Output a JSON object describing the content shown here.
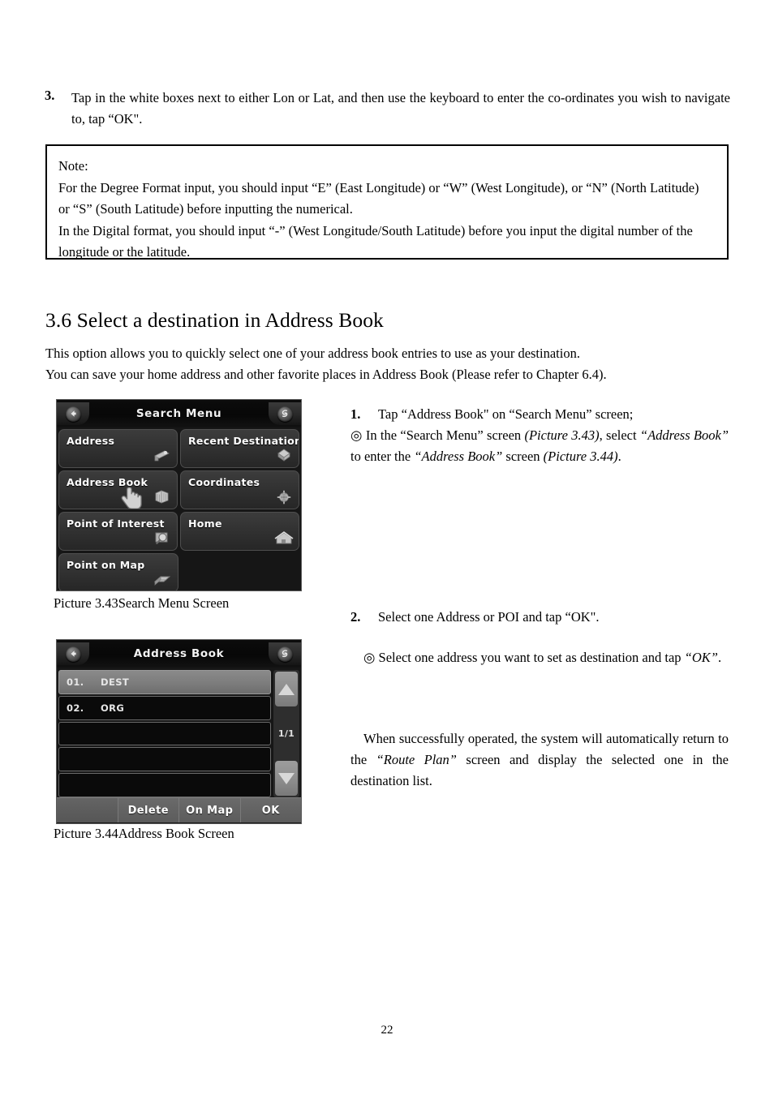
{
  "document": {
    "page_number": "22"
  },
  "step3": {
    "number": "3.",
    "text": "Tap in the white boxes next to either Lon or Lat, and then use the keyboard to enter the co-ordinates you wish to navigate to, tap “OK\"."
  },
  "note_box": {
    "label": "Note:",
    "lines": [
      "For the Degree Format input, you should input “E” (East Longitude) or “W” (West Longitude), or “N” (North Latitude)",
      "or “S” (South Latitude) before inputting the numerical.",
      "In the Digital format, you should input “-” (West Longitude/South Latitude) before you input the digital number of the",
      "longitude or the latitude."
    ]
  },
  "section": {
    "heading": "3.6 Select a destination in Address Book",
    "intro_line_1": "This option allows you to quickly select one of your address book entries to use as your destination.",
    "intro_line_2": "You can save your home address and other favorite places in Address Book (Please refer to Chapter 6.4)."
  },
  "search_menu_screen": {
    "title": "Search Menu",
    "back_icon": "back-arrow-icon",
    "right_icon": "swirl-icon",
    "buttons": [
      {
        "label": "Address",
        "icon": "road-sign-icon"
      },
      {
        "label": "Recent Destinations",
        "icon": "diamond-marker-icon"
      },
      {
        "label": "Address Book",
        "icon": "book-stack-icon"
      },
      {
        "label": "Coordinates",
        "icon": "globe-crosshair-icon"
      },
      {
        "label": "Point of Interest",
        "icon": "magnifier-map-icon"
      },
      {
        "label": "Home",
        "icon": "house-icon"
      },
      {
        "label": "Point on Map",
        "icon": "map-fold-icon"
      }
    ],
    "cursor": "hand-pointer-cursor"
  },
  "address_book_screen": {
    "title": "Address Book",
    "back_icon": "back-arrow-icon",
    "right_icon": "swirl-icon",
    "rows": [
      {
        "index": "01.",
        "name": "DEST",
        "selected": true
      },
      {
        "index": "02.",
        "name": "ORG",
        "selected": false
      },
      {
        "index": "",
        "name": "",
        "selected": false
      },
      {
        "index": "",
        "name": "",
        "selected": false
      },
      {
        "index": "",
        "name": "",
        "selected": false
      }
    ],
    "page_indicator": "1/1",
    "scroll_up_icon": "triangle-up-icon",
    "scroll_down_icon": "triangle-down-icon",
    "footer_buttons": [
      {
        "label": ""
      },
      {
        "label": "Delete"
      },
      {
        "label": "On Map"
      },
      {
        "label": "OK"
      }
    ]
  },
  "captions": {
    "picture_343": "Picture 3.43Search Menu Screen",
    "picture_344": "Picture 3.44Address Book Screen"
  },
  "right_column": {
    "item1_number": "1.",
    "item1_text": "Tap “Address Book\" on “Search Menu” screen;",
    "bullet_symbol": "◎",
    "para1_part1": " In the ",
    "para1_q1": "“Search Menu”",
    "para1_part2": " screen ",
    "para1_i1": "(Picture 3.43)",
    "para1_part3": ", select ",
    "para1_i2": "“Address Book”",
    "para1_part4": " to enter the ",
    "para1_i3": "“Address Book”",
    "para1_part5": " screen ",
    "para1_i4": "(Picture 3.44)",
    "para1_part6": ".",
    "item2_number": "2.",
    "item2_text": "Select one Address or POI and tap “OK\".",
    "para2_part1": " Select one address you want to set as destination and tap ",
    "para2_i1": "“OK”",
    "para2_part2": ".",
    "para3_part1": "When successfully operated, the system will automatically return to the ",
    "para3_i1": "“Route Plan”",
    "para3_part2": " screen and display the selected one in the destination list."
  }
}
